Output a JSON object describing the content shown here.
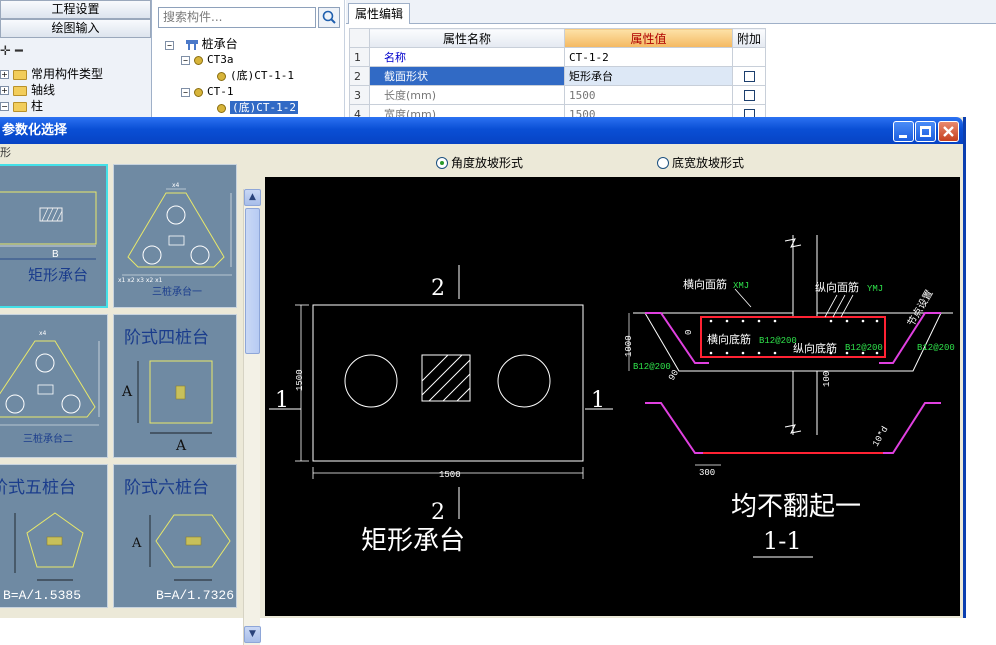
{
  "app": {
    "left_nav": {
      "buttons": [
        "工程设置",
        "绘图输入"
      ],
      "tree_tools": "✛ ━",
      "tree_items": [
        "常用构件类型",
        "轴线",
        "柱"
      ]
    },
    "component_panel": {
      "search_placeholder": "搜索构件...",
      "tree": {
        "root": "桩承台",
        "groups": [
          {
            "name": "CT3a",
            "children": [
              "(底)CT-1-1"
            ]
          },
          {
            "name": "CT-1",
            "children": [
              "(底)CT-1-2"
            ]
          }
        ]
      }
    },
    "property_panel": {
      "tab_label": "属性编辑",
      "headers": {
        "name": "属性名称",
        "value": "属性值",
        "extra": "附加"
      },
      "rows": [
        {
          "index": "1",
          "name": "名称",
          "value": "CT-1-2",
          "has_check": false
        },
        {
          "index": "2",
          "name": "截面形状",
          "value": "矩形承台",
          "has_check": true
        },
        {
          "index": "3",
          "name": "长度(mm)",
          "value": "1500",
          "has_check": true
        },
        {
          "index": "4",
          "name": "宽度(mm)",
          "value": "1500",
          "has_check": true
        }
      ]
    }
  },
  "dialog": {
    "title": "参数化选择",
    "corner_label": "形",
    "options": {
      "angle": "角度放坡形式",
      "width": "底宽放坡形式",
      "selected": "angle"
    },
    "thumbnails": [
      {
        "label": "矩形承台",
        "dim": "B",
        "selected": true
      },
      {
        "label": "三桩承台一",
        "dim": "",
        "selected": false
      },
      {
        "label": "三桩承台二",
        "dim": "",
        "selected": false
      },
      {
        "label": "阶式四桩台",
        "dim": "A",
        "selected": false
      },
      {
        "label": "阶式五桩台",
        "dim": "B=A/1.5385",
        "selected": false
      },
      {
        "label": "阶式六桩台",
        "dim": "B=A/1.7326",
        "selected": false
      }
    ],
    "drawing": {
      "title": "矩形承台",
      "section_mark": "1",
      "section_mark_2": "2",
      "width_dim": "1500",
      "height_dim": "1500",
      "section_title": "均不翻起一",
      "section_subtitle": "1-1",
      "labels": {
        "top_horizontal": "横向面筋",
        "top_horizontal_code": "XMJ",
        "top_vertical": "纵向面筋",
        "top_vertical_code": "YMJ",
        "bottom_horizontal": "横向底筋",
        "bottom_horizontal_code": "B12@200",
        "bottom_vertical": "纵向底筋",
        "bottom_vertical_code": "B12@200",
        "left_code": "B12@200",
        "right_code": "B12@200",
        "side_note": "节点设置",
        "dim_1000": "1000",
        "dim_100": "100",
        "dim_0": "0",
        "angle": "90",
        "dim_300": "300",
        "dim_10d": "10*d"
      }
    }
  }
}
